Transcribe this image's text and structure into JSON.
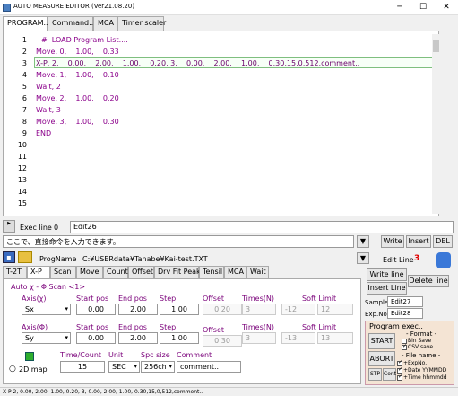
{
  "window": {
    "title": "AUTO MEASURE EDITOR  (Ver21.08.20)"
  },
  "top_tabs": [
    "PROGRAM..",
    "Command..",
    "MCA",
    "Timer scaler"
  ],
  "editor": {
    "lines": [
      {
        "num": "1",
        "text": "#  LOAD Program List...."
      },
      {
        "num": "2",
        "text": "Move, 0,    1.00,    0.33"
      },
      {
        "num": "3",
        "text": "X-P, 2,    0.00,    2.00,    1.00,    0.20, 3,    0.00,    2.00,    1.00,    0.30,15,0,512,comment.."
      },
      {
        "num": "4",
        "text": "Move, 1,    1.00,    0.10"
      },
      {
        "num": "5",
        "text": "Wait, 2"
      },
      {
        "num": "6",
        "text": "Move, 2,    1.00,    0.20"
      },
      {
        "num": "7",
        "text": "Wait, 3"
      },
      {
        "num": "8",
        "text": "Move, 3,    1.00,    0.30"
      },
      {
        "num": "9",
        "text": "END"
      },
      {
        "num": "10",
        "text": ""
      },
      {
        "num": "11",
        "text": ""
      },
      {
        "num": "12",
        "text": ""
      },
      {
        "num": "13",
        "text": ""
      },
      {
        "num": "14",
        "text": ""
      },
      {
        "num": "15",
        "text": ""
      }
    ]
  },
  "exec": {
    "label": "Exec line",
    "value": "0",
    "edit": "Edit26"
  },
  "command": {
    "text": "ここで、直接命令を入力できます。",
    "write": "Write",
    "insert": "Insert",
    "del": "DEL"
  },
  "prog": {
    "label": "ProgName",
    "path": "C:¥USERdata¥Tanabe¥Kai-test.TXT",
    "editline_label": "Edit Line",
    "editline_value": "3"
  },
  "bottom_tabs": [
    "T-2T",
    "X-P",
    "Scan",
    "Move",
    "Count",
    "Offset",
    "Drv Fit Peak",
    "Tensil",
    "MCA",
    "Wait"
  ],
  "scan": {
    "title": "Auto χ - Φ Scan <1>",
    "headers1": {
      "axis": "Axis(χ)",
      "start": "Start pos",
      "end": "End pos",
      "step": "Step",
      "offset": "Offset",
      "times": "Times(N)",
      "soft": "Soft Limit"
    },
    "row1": {
      "axis": "Sx",
      "start": "0.00",
      "end": "2.00",
      "step": "1.00",
      "offset": "0.20",
      "times": "3",
      "soft_lo": "-12",
      "soft_hi": "12"
    },
    "headers2": {
      "axis": "Axis(Φ)",
      "start": "Start pos",
      "end": "End pos",
      "step": "Step",
      "offset": "Offset",
      "times": "Times(N)",
      "soft": "Soft Limit"
    },
    "row2": {
      "axis": "Sy",
      "start": "0.00",
      "end": "2.00",
      "step": "1.00",
      "offset": "0.30",
      "times": "3",
      "soft_lo": "-13",
      "soft_hi": "13"
    },
    "map_label": "2D map",
    "time_label": "Time/Count",
    "time_value": "15",
    "unit_label": "Unit",
    "unit_value": "SEC",
    "spc_label": "Spc size",
    "spc_value": "256ch",
    "comment_label": "Comment",
    "comment_value": "comment.."
  },
  "side": {
    "write_line": "Write line",
    "insert_line": "Insert Line",
    "delete_line": "Delete line",
    "sample_label": "Sample",
    "sample_value": "Edit27",
    "expno_label": "Exp.No",
    "expno_value": "Edit28"
  },
  "progexec": {
    "title": "Program exec..",
    "format": "- Format -",
    "bin": "Bin Save",
    "csv": "CSV save",
    "start": "START",
    "abort": "ABORT",
    "stp": "STP",
    "cont": "Cont",
    "filename": "- File name -",
    "expno": "+ExpNo.",
    "date": "+Date YYMMDD",
    "time": "+Time hhmmdd"
  },
  "status": "X-P 2,   0.00,   2.00,   1.00,   0.20, 3,   0.00,   2.00,   1.00,   0.30,15,0,512,comment..",
  "colors": {
    "code": "#8b008b",
    "editline_value": "#e00000"
  }
}
